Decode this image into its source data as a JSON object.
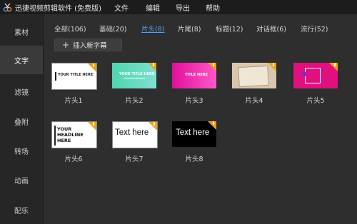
{
  "window": {
    "title": "迅捷视频剪辑软件 (免费版)",
    "menu": [
      "文件",
      "编辑",
      "导出",
      "帮助"
    ]
  },
  "sidebar": {
    "items": [
      {
        "label": "素材"
      },
      {
        "label": "文字",
        "active": true
      },
      {
        "label": "滤镜"
      },
      {
        "label": "叠附"
      },
      {
        "label": "转场"
      },
      {
        "label": "动画"
      },
      {
        "label": "配乐"
      }
    ]
  },
  "tabs": [
    {
      "label": "全部(106)"
    },
    {
      "label": "基础(20)"
    },
    {
      "label": "片头(8)",
      "active": true
    },
    {
      "label": "片尾(8)"
    },
    {
      "label": "标题(12)"
    },
    {
      "label": "对话框(6)"
    },
    {
      "label": "流行(52)"
    }
  ],
  "insert_button": {
    "label": "插入新字幕"
  },
  "templates": [
    {
      "caption": "片头1",
      "text": "YOUR TITLE HERE"
    },
    {
      "caption": "片头2",
      "text": "YOUR TITLE HERE"
    },
    {
      "caption": "片头3",
      "text": "TITLE HERE"
    },
    {
      "caption": "片头4",
      "text": ""
    },
    {
      "caption": "片头5",
      "text": ""
    },
    {
      "caption": "片头6",
      "text": "YOUR HEADLINE HERE"
    },
    {
      "caption": "片头7",
      "text": "Text here"
    },
    {
      "caption": "片头8",
      "text": "Text here"
    }
  ],
  "colors": {
    "accent": "#4fa3ff",
    "download_badge": "#e8a317"
  }
}
